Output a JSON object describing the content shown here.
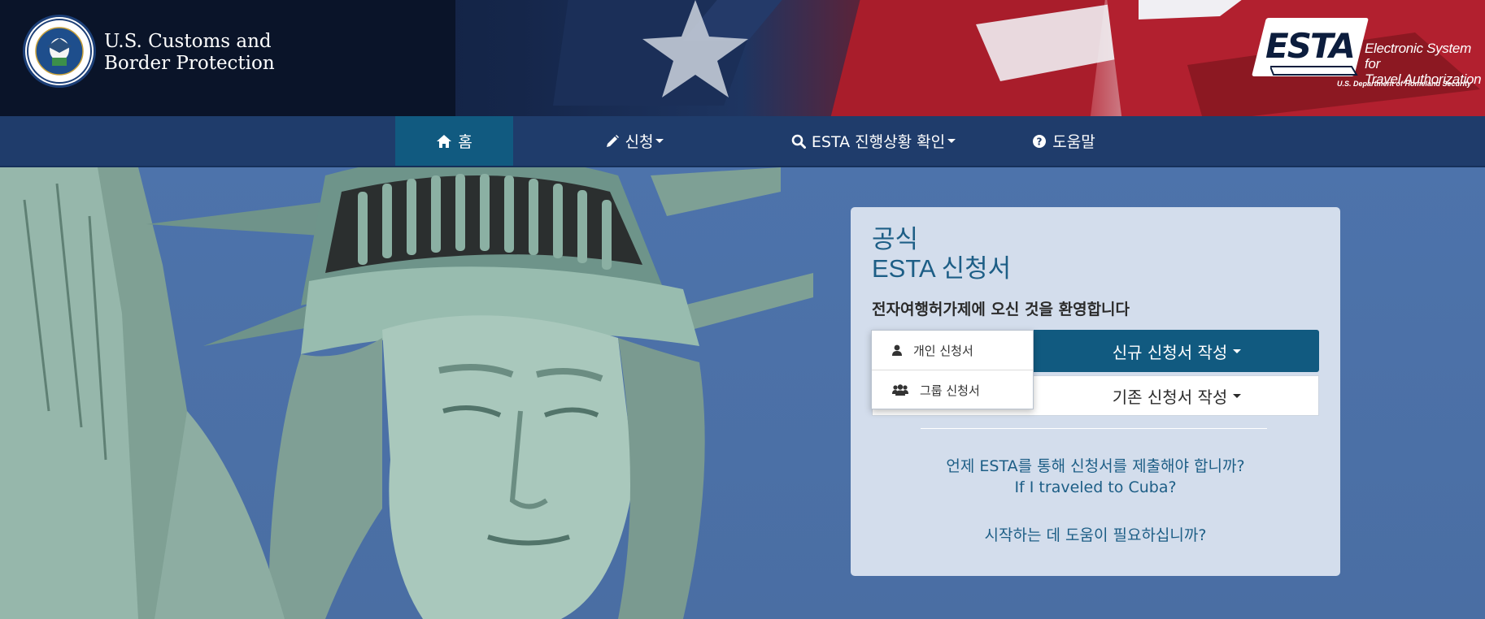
{
  "header": {
    "agency_line1": "U.S. Customs and",
    "agency_line2": "Border Protection",
    "seal_text": "U.S. DEPARTMENT OF HOMELAND SECURITY",
    "esta_word": "ESTA",
    "esta_sub_line1": "Electronic System for",
    "esta_sub_line2": "Travel Authorization",
    "esta_dept": "U.S. Department of Homeland Security"
  },
  "nav": {
    "items": [
      {
        "label": "홈",
        "icon": "home-icon"
      },
      {
        "label": "신청",
        "icon": "pencil-icon"
      },
      {
        "label": "ESTA 진행상황 확인",
        "icon": "search-icon"
      },
      {
        "label": "도움말",
        "icon": "help-circle-icon"
      }
    ]
  },
  "panel": {
    "title_line1": "공식",
    "title_line2": "ESTA 신청서",
    "welcome": "전자여행허가제에 오신 것을 환영합니다",
    "new_application": "신규 신청서 작성",
    "existing_application": "기존 신청서 작성",
    "link_when": "언제 ESTA를 통해 신청서를 제출해야 합니까?",
    "link_cuba": "If I traveled to Cuba?",
    "link_help": "시작하는 데 도움이 필요하십니까?"
  },
  "dropdown": {
    "items": [
      {
        "label": "개인 신청서",
        "icon": "user-icon"
      },
      {
        "label": "그룹 신청서",
        "icon": "users-icon"
      }
    ]
  },
  "colors": {
    "nav_bg": "#1f3c6b",
    "nav_active": "#115a80",
    "primary_button": "#115a80",
    "link_text": "#1d5e86"
  }
}
